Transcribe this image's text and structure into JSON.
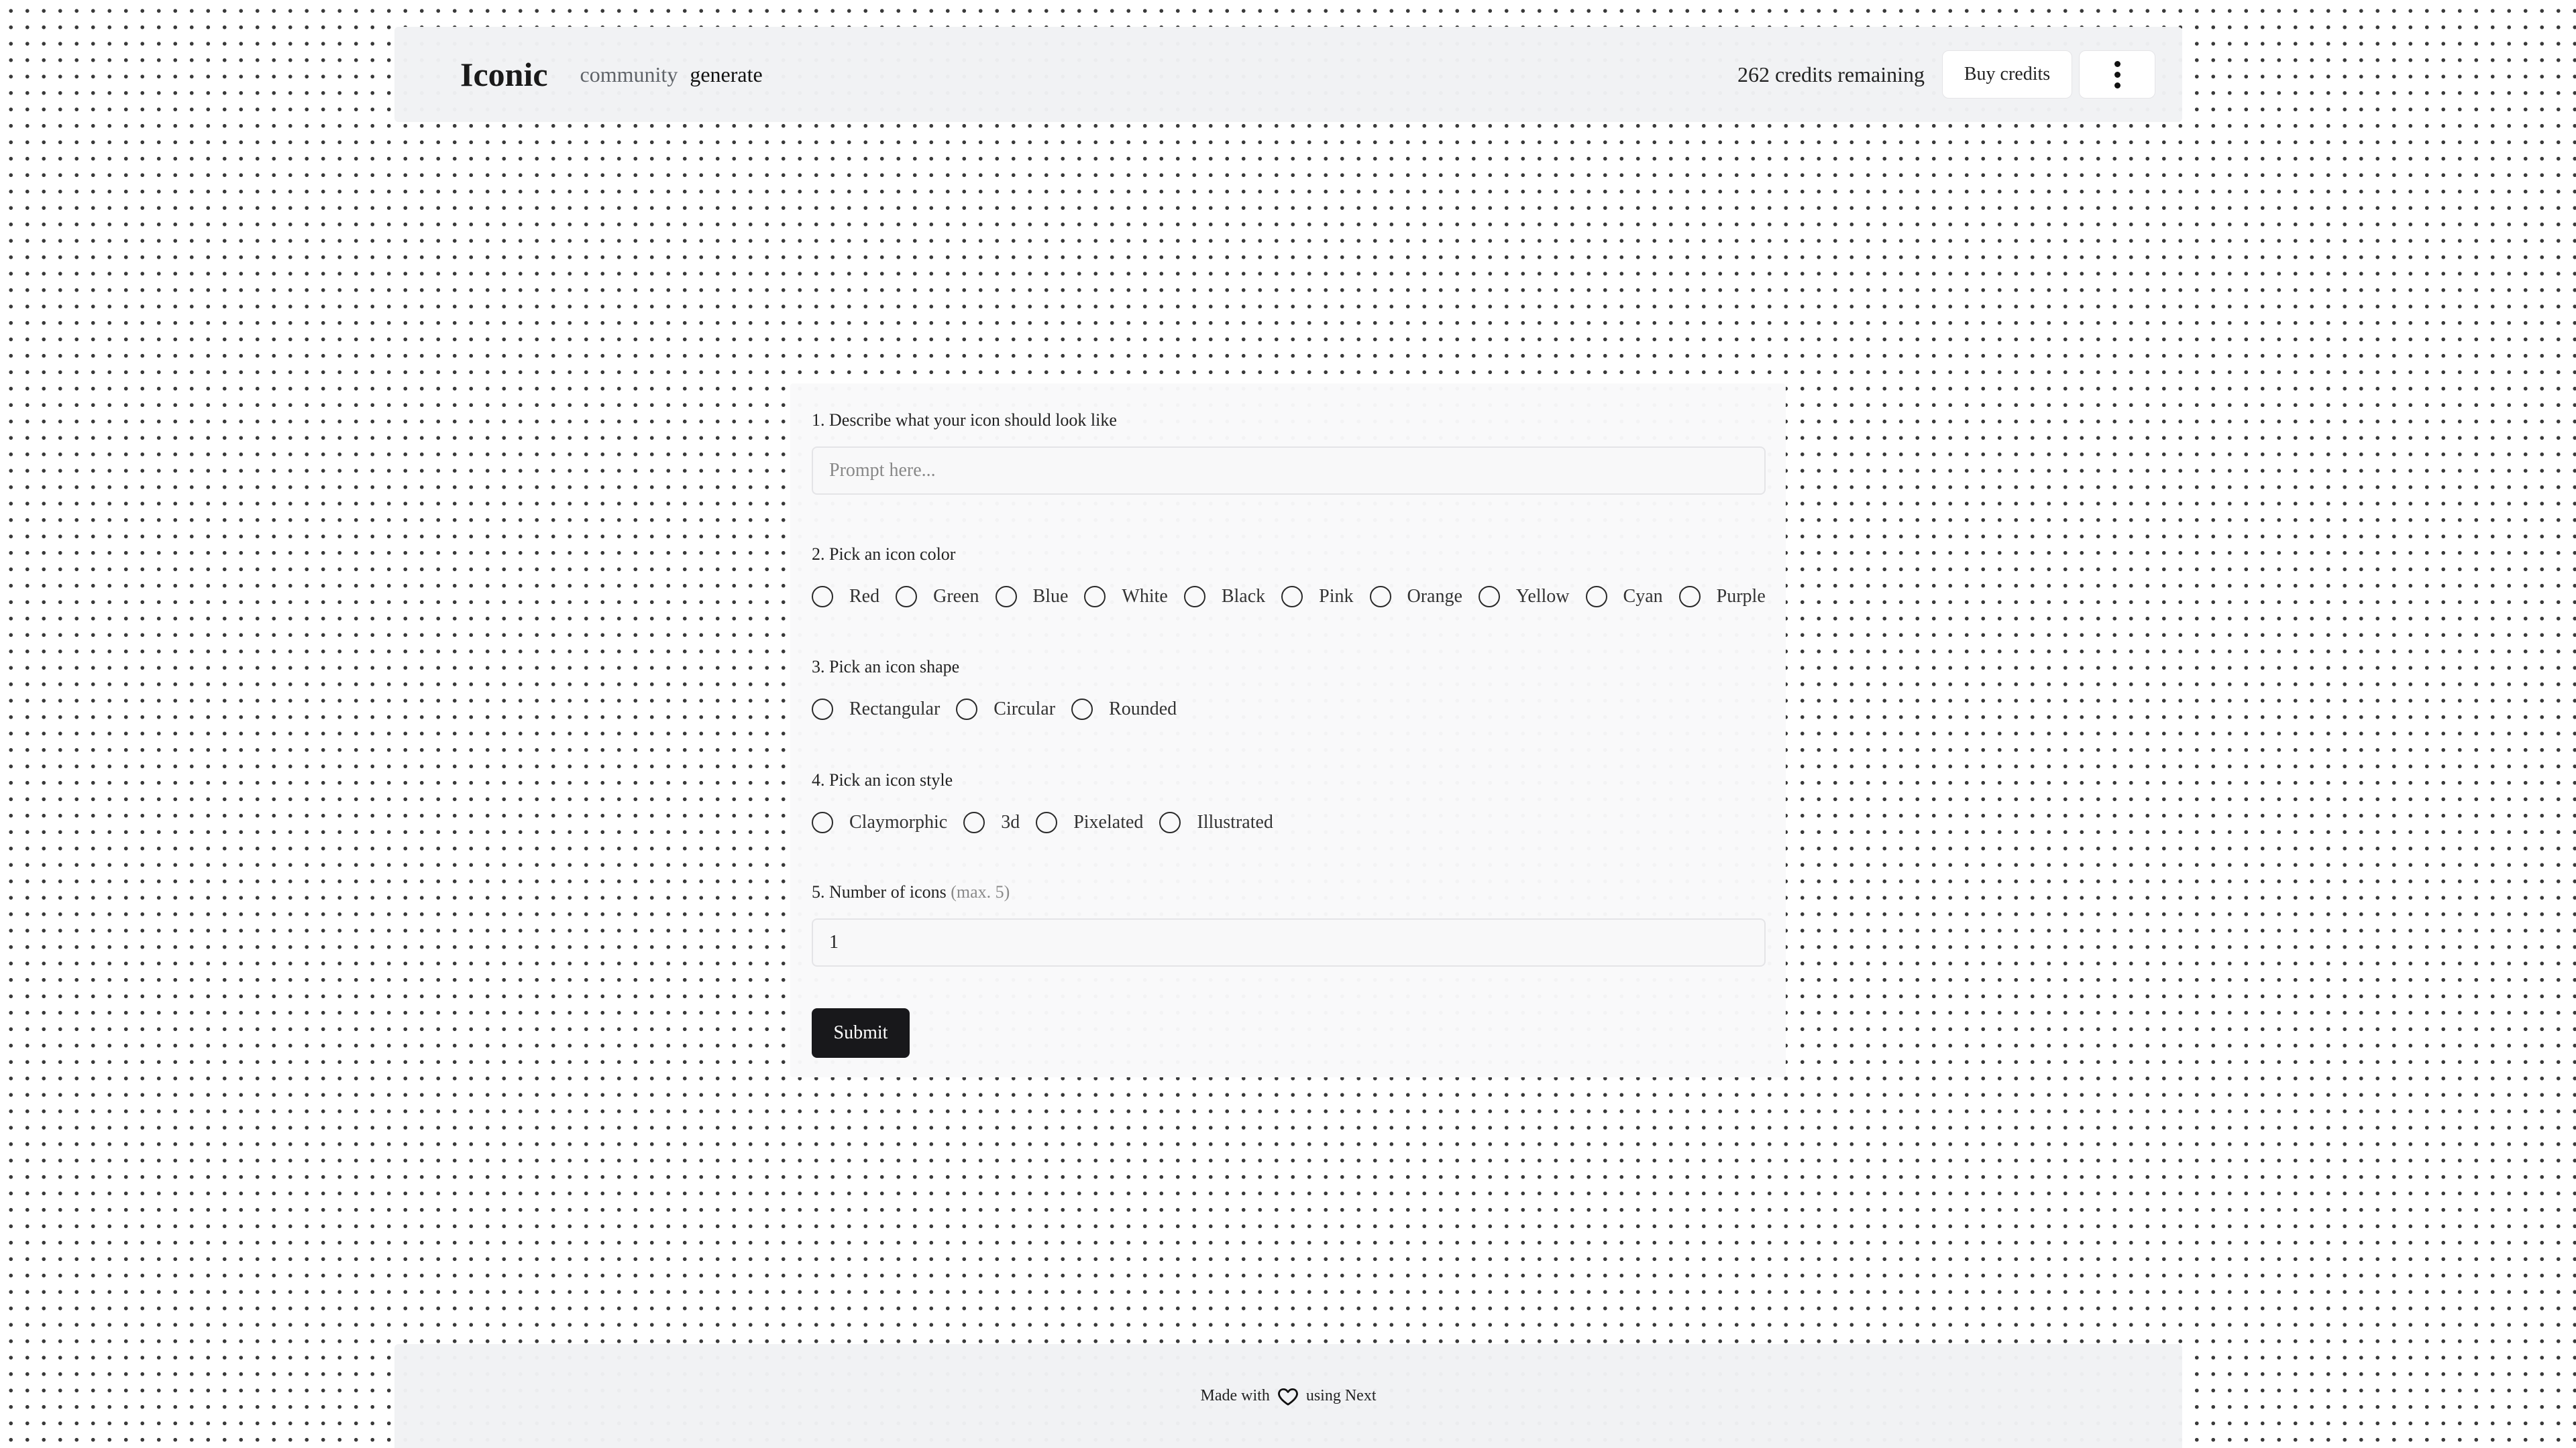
{
  "header": {
    "logo": "Iconic",
    "nav": [
      {
        "label": "community"
      },
      {
        "label": "generate"
      }
    ],
    "credits": "262 credits remaining",
    "buy_label": "Buy credits",
    "menu_icon": "more-vertical-icon"
  },
  "form": {
    "q1": {
      "label": "1. Describe what your icon should look like",
      "placeholder": "Prompt here...",
      "value": ""
    },
    "q2": {
      "label": "2. Pick an icon color",
      "options": [
        "Red",
        "Green",
        "Blue",
        "White",
        "Black",
        "Pink",
        "Orange",
        "Yellow",
        "Cyan",
        "Purple"
      ]
    },
    "q3": {
      "label": "3. Pick an icon shape",
      "options": [
        "Rectangular",
        "Circular",
        "Rounded"
      ]
    },
    "q4": {
      "label": "4. Pick an icon style",
      "options": [
        "Claymorphic",
        "3d",
        "Pixelated",
        "Illustrated"
      ]
    },
    "q5": {
      "label": "5. Number of icons",
      "hint": "(max. 5)",
      "value": "1"
    },
    "submit_label": "Submit"
  },
  "footer": {
    "made_with": "Made with",
    "heart_icon": "heart-icon",
    "using": "using",
    "tech": "Next"
  }
}
